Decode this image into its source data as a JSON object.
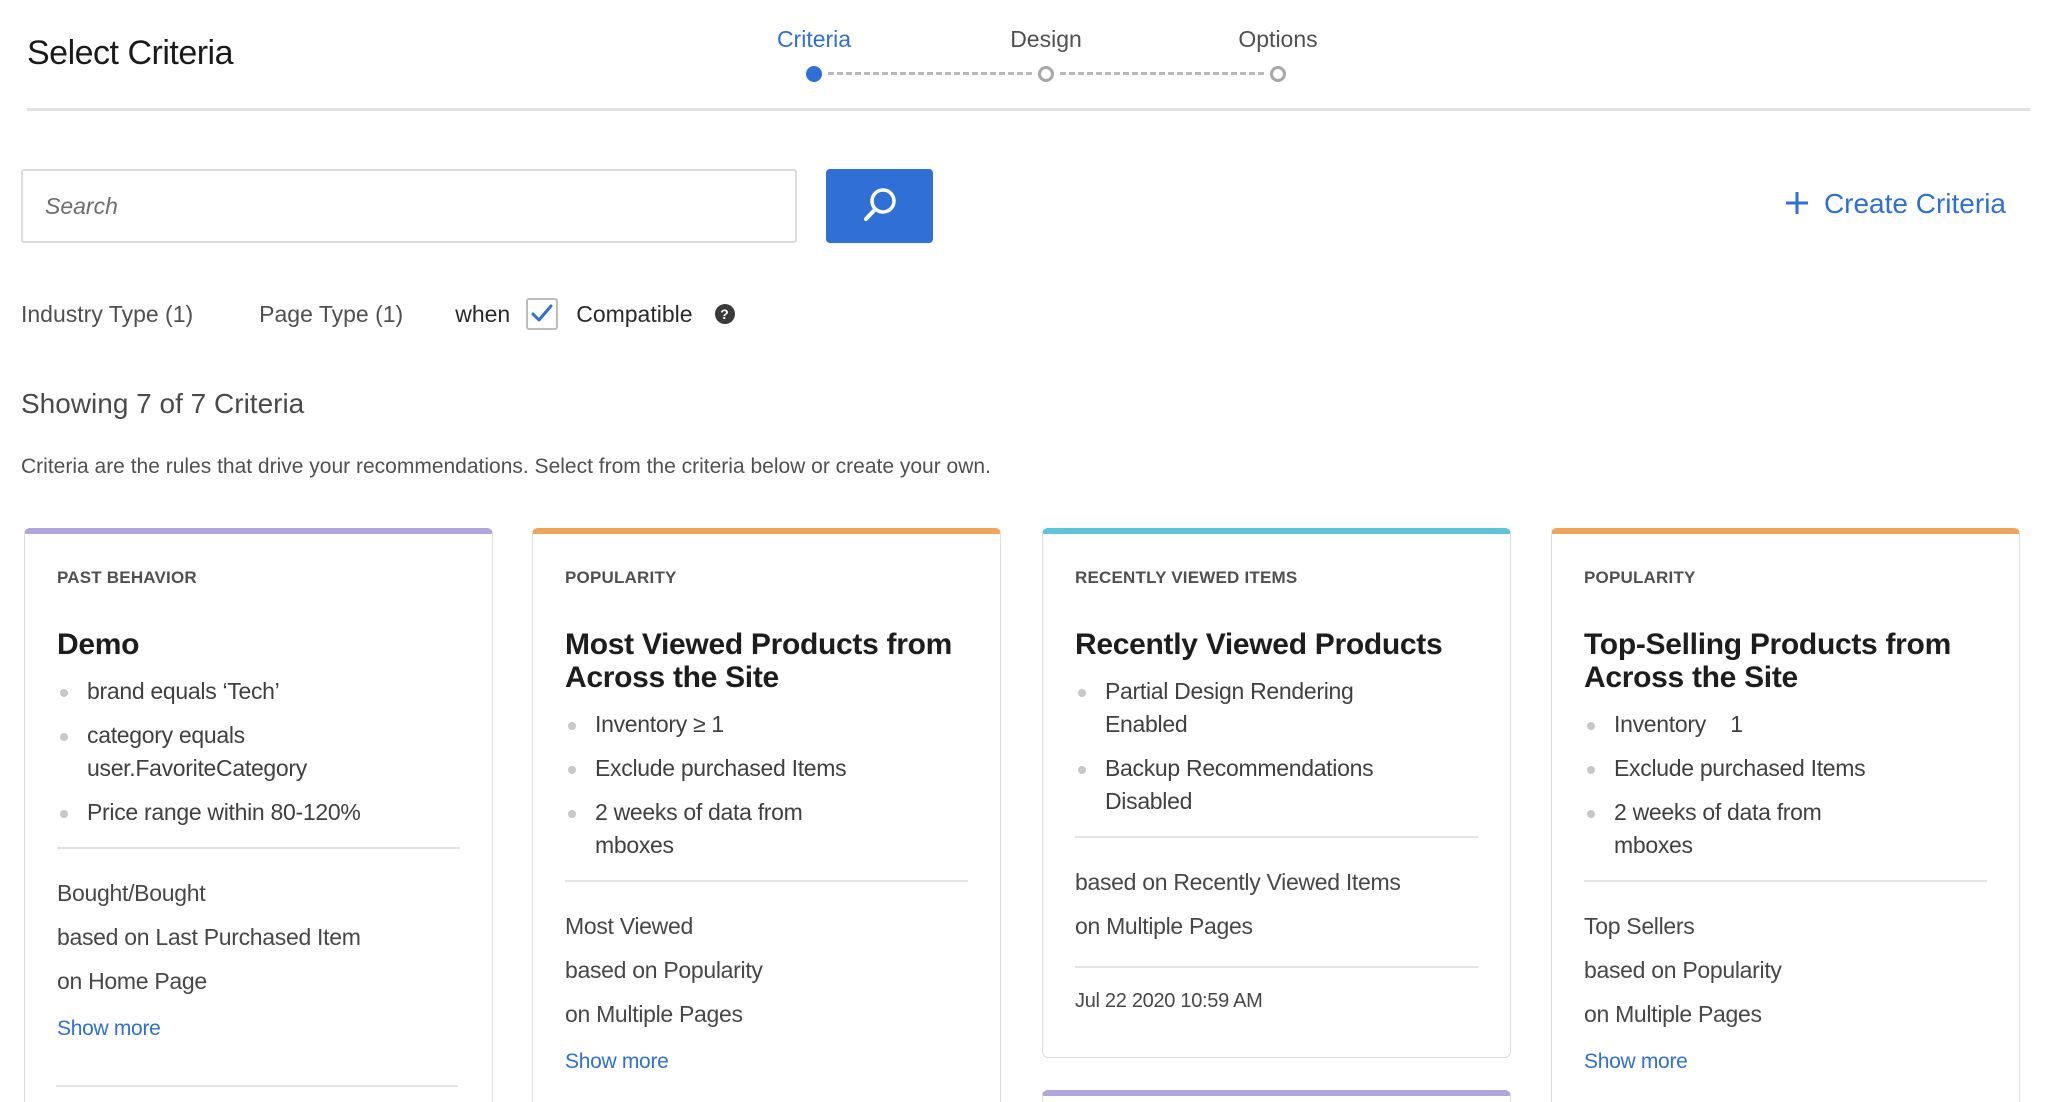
{
  "header": {
    "title": "Select Criteria",
    "steps": [
      {
        "label": "Criteria",
        "active": true
      },
      {
        "label": "Design",
        "active": false
      },
      {
        "label": "Options",
        "active": false
      }
    ]
  },
  "search": {
    "placeholder": "Search",
    "value": ""
  },
  "create_label": "Create Criteria",
  "filters": {
    "industry": "Industry Type (1)",
    "page": "Page Type (1)",
    "when": "when",
    "compatible_checked": true,
    "compatible": "Compatible",
    "help": "?"
  },
  "showing": "Showing 7 of 7 Criteria",
  "description": "Criteria are the rules that drive your recommendations. Select from the criteria below or create your own.",
  "colors": {
    "accent": "#2f6fd6",
    "past_behavior": "#b3a4dc",
    "popularity": "#f0a35a",
    "recently_viewed": "#5ec6d6"
  },
  "cards": [
    {
      "category": "PAST BEHAVIOR",
      "title": "Demo",
      "rules": [
        "brand equals ‘Tech’",
        "category equals user.FavoriteCategory",
        "Price range within 80-120%"
      ],
      "meta": [
        "Bought/Bought",
        "based on Last Purchased Item",
        "on Home Page"
      ],
      "show_more": "Show more"
    },
    {
      "category": "POPULARITY",
      "title": "Most Viewed Products from Across the Site",
      "rules": [
        "Inventory ≥ 1",
        "Exclude purchased Items",
        "2 weeks of data from mboxes"
      ],
      "meta": [
        "Most Viewed",
        "based on Popularity",
        "on Multiple Pages"
      ],
      "show_more": "Show more"
    },
    {
      "category": "RECENTLY VIEWED ITEMS",
      "title": "Recently Viewed Products",
      "rules": [
        "Partial Design Rendering Enabled",
        "Backup Recommendations Disabled"
      ],
      "meta": [
        "based on Recently Viewed Items",
        "on Multiple Pages"
      ],
      "date": "Jul 22 2020 10:59 AM"
    },
    {
      "category": "POPULARITY",
      "title": "Top-Selling Products from Across the Site",
      "rules": [
        "Inventory    1",
        "Exclude purchased Items",
        "2 weeks of data from mboxes"
      ],
      "meta": [
        "Top Sellers",
        "based on Popularity",
        "on Multiple Pages"
      ],
      "show_more": "Show more"
    }
  ]
}
